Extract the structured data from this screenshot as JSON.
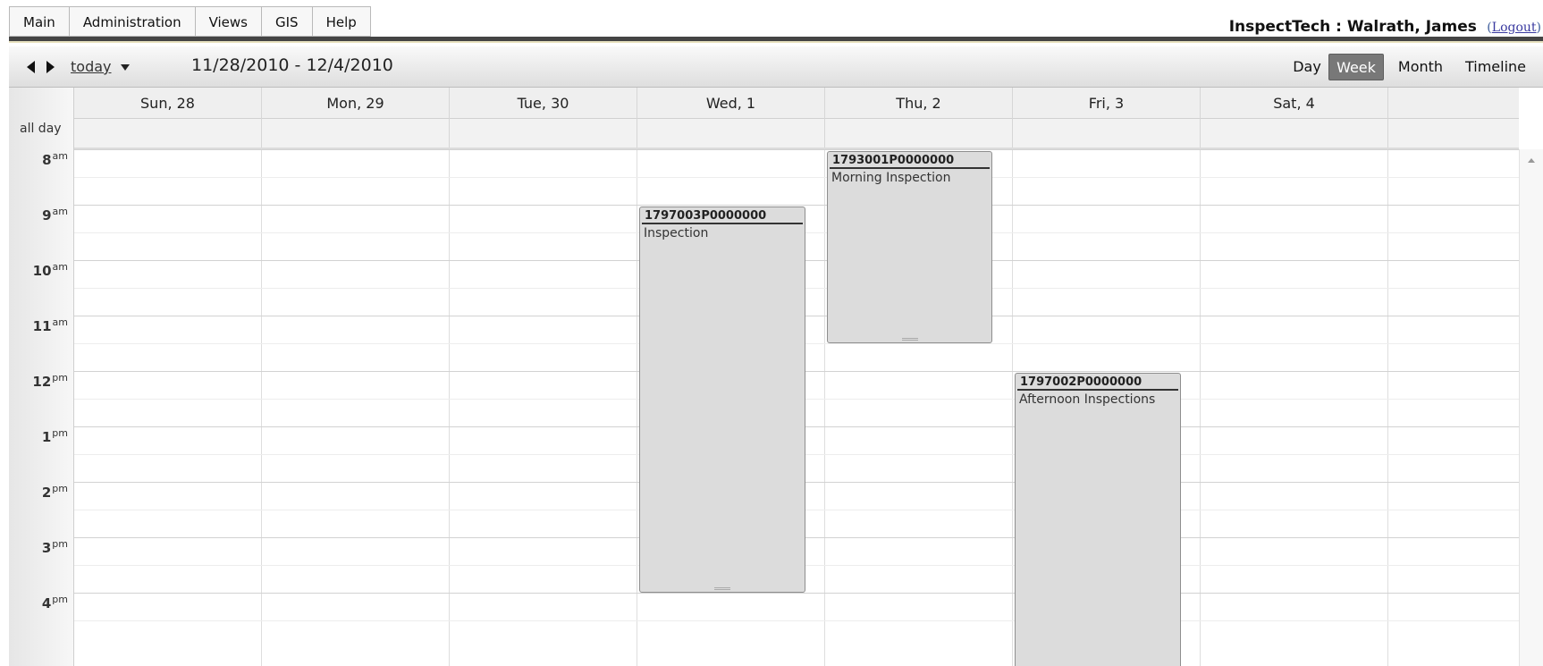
{
  "menu": {
    "items": [
      {
        "label": "Main"
      },
      {
        "label": "Administration"
      },
      {
        "label": "Views"
      },
      {
        "label": "GIS"
      },
      {
        "label": "Help"
      }
    ]
  },
  "user": {
    "app_and_user": "InspectTech : Walrath, James",
    "logout_open": "(",
    "logout_label": "Logout",
    "logout_close": ")"
  },
  "toolbar": {
    "today_label": "today",
    "date_range": "11/28/2010 - 12/4/2010",
    "views": {
      "day": "Day",
      "week": "Week",
      "month": "Month",
      "timeline": "Timeline"
    },
    "active_view": "Week"
  },
  "calendar": {
    "allday_label": "all day",
    "days": [
      "Sun, 28",
      "Mon, 29",
      "Tue, 30",
      "Wed, 1",
      "Thu, 2",
      "Fri, 3",
      "Sat, 4"
    ],
    "hours": [
      {
        "hour": "8",
        "suffix": "am"
      },
      {
        "hour": "9",
        "suffix": "am"
      },
      {
        "hour": "10",
        "suffix": "am"
      },
      {
        "hour": "11",
        "suffix": "am"
      },
      {
        "hour": "12",
        "suffix": "pm"
      },
      {
        "hour": "1",
        "suffix": "pm"
      },
      {
        "hour": "2",
        "suffix": "pm"
      },
      {
        "hour": "3",
        "suffix": "pm"
      },
      {
        "hour": "4",
        "suffix": "pm"
      }
    ],
    "events": [
      {
        "id": "1797003P0000000",
        "title": "Inspection",
        "day": "Wed, 1",
        "start": "9:00",
        "end": "4:00"
      },
      {
        "id": "1793001P0000000",
        "title": "Morning Inspection",
        "day": "Thu, 2",
        "start": "8:00",
        "end": "11:30"
      },
      {
        "id": "1797002P0000000",
        "title": "Afternoon Inspections",
        "day": "Fri, 3",
        "start": "12:00",
        "end": ""
      }
    ]
  }
}
